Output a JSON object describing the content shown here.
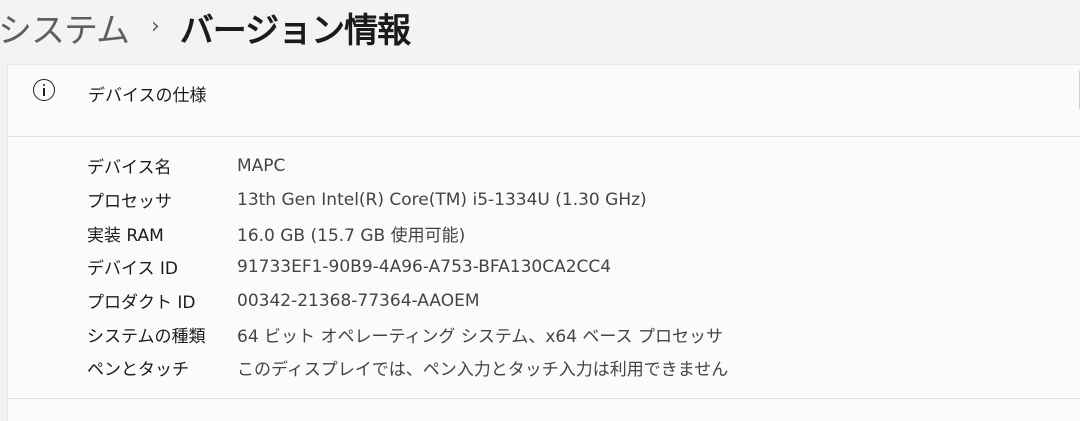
{
  "breadcrumb": {
    "parent": "システム",
    "separator": "›",
    "current": "バージョン情報"
  },
  "device_specs": {
    "title": "デバイスの仕様",
    "icon": "info-icon",
    "rows": [
      {
        "label": "デバイス名",
        "value": "MAPC"
      },
      {
        "label": "プロセッサ",
        "value": "13th Gen Intel(R) Core(TM) i5-1334U (1.30 GHz)"
      },
      {
        "label": "実装 RAM",
        "value": "16.0 GB (15.7 GB 使用可能)"
      },
      {
        "label": "デバイス ID",
        "value": "91733EF1-90B9-4A96-A753-BFA130CA2CC4"
      },
      {
        "label": "プロダクト ID",
        "value": "00342-21368-77364-AAOEM"
      },
      {
        "label": "システムの種類",
        "value": "64 ビット オペレーティング システム、x64 ベース プロセッサ"
      },
      {
        "label": "ペンとタッチ",
        "value": "このディスプレイでは、ペン入力とタッチ入力は利用できません"
      }
    ]
  }
}
